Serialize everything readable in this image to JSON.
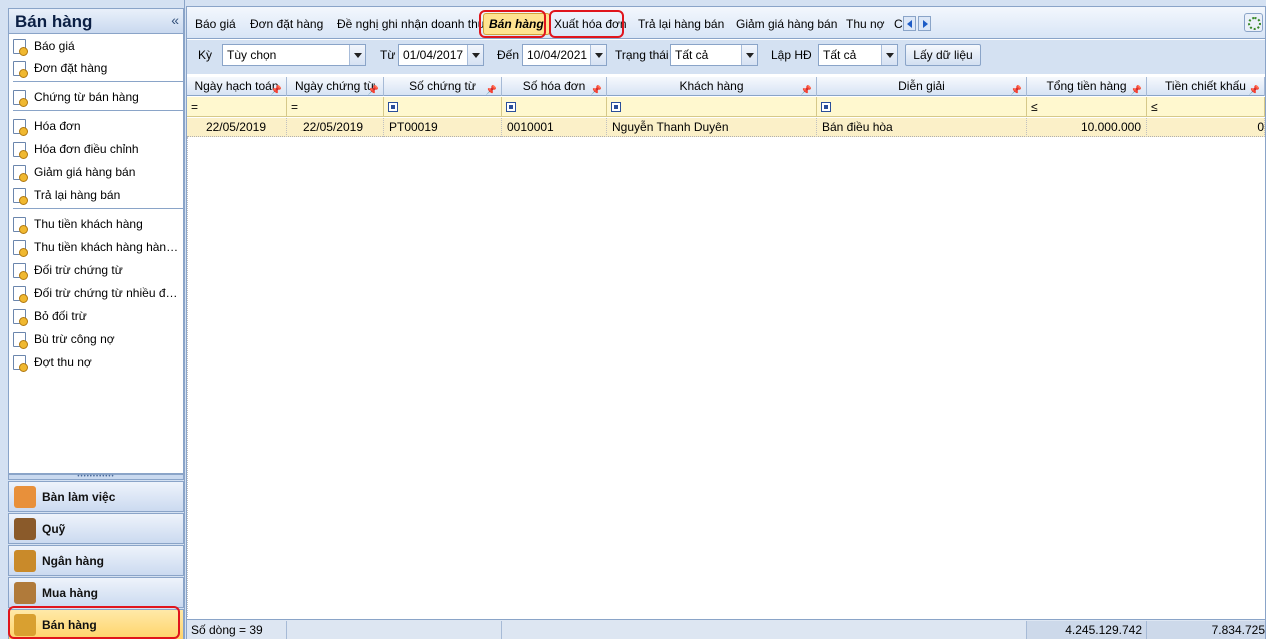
{
  "left_panel": {
    "title": "Bán hàng",
    "collapse_icon": "double-chevron-left-icon",
    "items": [
      {
        "label": "Báo giá"
      },
      {
        "label": "Đơn đặt hàng"
      },
      {
        "label": "Chứng từ bán hàng"
      },
      {
        "label": "Hóa đơn"
      },
      {
        "label": "Hóa đơn điều chỉnh"
      },
      {
        "label": "Giảm giá hàng bán"
      },
      {
        "label": "Trả lại hàng bán"
      },
      {
        "label": "Thu tiền khách hàng"
      },
      {
        "label": "Thu tiền khách hàng hàng l..."
      },
      {
        "label": "Đối trừ chứng từ"
      },
      {
        "label": "Đối trừ chứng từ nhiều đối t..."
      },
      {
        "label": "Bỏ đối trừ"
      },
      {
        "label": "Bù trừ công nợ"
      },
      {
        "label": "Đợt thu nợ"
      }
    ],
    "modules": [
      {
        "label": "Bàn làm việc",
        "icon": "desktop-icon",
        "color": "#e8903a"
      },
      {
        "label": "Quỹ",
        "icon": "safe-icon",
        "color": "#8a5a2a"
      },
      {
        "label": "Ngân hàng",
        "icon": "bank-icon",
        "color": "#c98a2a"
      },
      {
        "label": "Mua hàng",
        "icon": "purchase-icon",
        "color": "#b07a3a"
      },
      {
        "label": "Bán hàng",
        "icon": "sales-icon",
        "color": "#d9a030"
      }
    ]
  },
  "tabs": [
    {
      "label": "Báo giá"
    },
    {
      "label": "Đơn đặt hàng"
    },
    {
      "label": "Đề nghị ghi nhận doanh thu"
    },
    {
      "label": "Bán hàng"
    },
    {
      "label": "Xuất hóa đơn"
    },
    {
      "label": "Trả lại hàng bán"
    },
    {
      "label": "Giảm giá hàng bán"
    },
    {
      "label": "Thu nợ"
    },
    {
      "label": "C"
    }
  ],
  "filters": {
    "period_label": "Kỳ",
    "period_value": "Tùy chọn",
    "from_label": "Từ",
    "from_value": "01/04/2017",
    "to_label": "Đến",
    "to_value": "10/04/2021",
    "status_label": "Trạng thái",
    "status_value": "Tất cả",
    "invoice_label": "Lập HĐ",
    "invoice_value": "Tất cả",
    "fetch_button": "Lấy dữ liệu"
  },
  "grid": {
    "columns": [
      {
        "label": "Ngày hạch toán"
      },
      {
        "label": "Ngày chứng từ"
      },
      {
        "label": "Số chứng từ"
      },
      {
        "label": "Số hóa đơn"
      },
      {
        "label": "Khách hàng"
      },
      {
        "label": "Diễn giải"
      },
      {
        "label": "Tổng tiền hàng"
      },
      {
        "label": "Tiền chiết khấu"
      }
    ],
    "filter_ops": [
      "=",
      "=",
      "",
      "",
      "",
      "",
      "≤",
      "≤"
    ],
    "rows": [
      {
        "posting_date": "22/05/2019",
        "voucher_date": "22/05/2019",
        "voucher_no": "PT00019",
        "invoice_no": "0010001",
        "customer": "Nguyễn Thanh Duyên",
        "description": "Bán điều hòa",
        "total": "10.000.000",
        "discount": "0"
      }
    ],
    "footer": {
      "row_count": "Số dòng = 39",
      "total_sum": "4.245.129.742",
      "discount_sum": "7.834.725"
    }
  },
  "colors": {
    "highlight": "#e0151c",
    "active_tab": "#ffe390",
    "selected_row": "#fbf0c8"
  }
}
